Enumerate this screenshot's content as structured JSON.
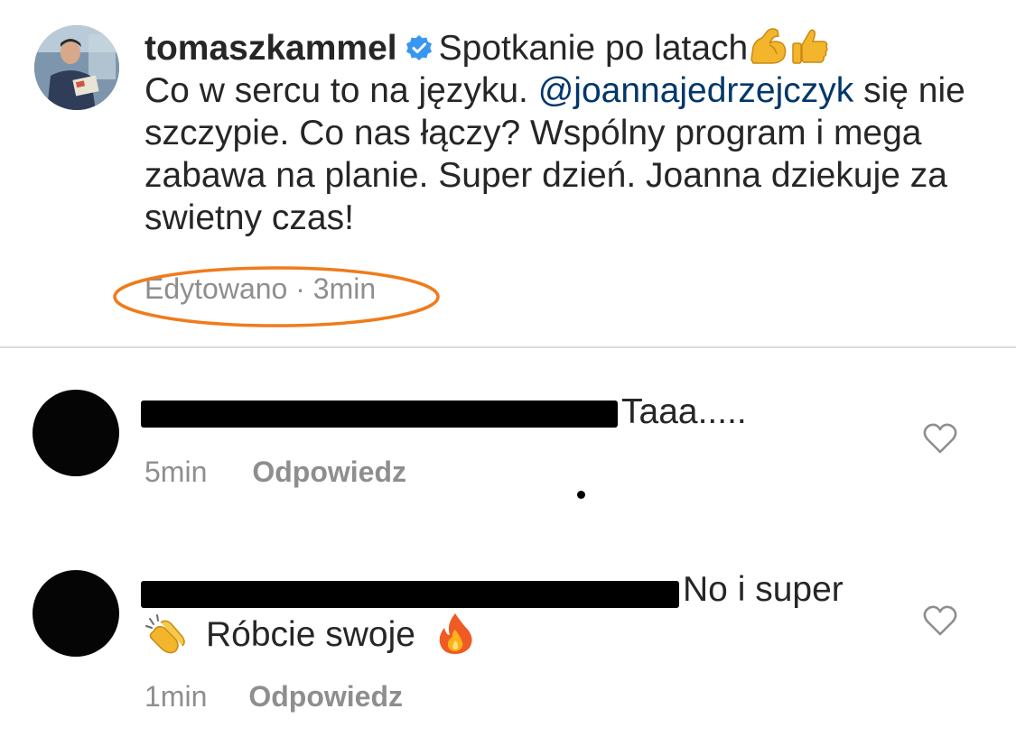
{
  "post": {
    "username": "tomaszkammel",
    "title": "Spotkanie po latach",
    "line1": "Co w sercu to na języku. ",
    "mention": "@joannajedrzejczyk",
    "line2": " się nie szczypie. Co nas łączy? Wspólny program i mega zabawa na planie. Super dzień. Joanna dziekuje za swietny czas!",
    "edited_label": "Edytowano",
    "separator": "·",
    "time": "3min",
    "emojis": [
      "flexed-biceps",
      "thumbs-up"
    ]
  },
  "comments": [
    {
      "text": "Taaa.....",
      "time": "5min",
      "reply_label": "Odpowiedz"
    },
    {
      "text_line1": "No i super",
      "text_line2": "Róbcie swoje",
      "time": "1min",
      "reply_label": "Odpowiedz",
      "emojis": [
        "clapping-hands",
        "fire"
      ]
    }
  ],
  "colors": {
    "text": "#262626",
    "muted": "#8e8e8e",
    "mention": "#00376b",
    "verified": "#3897f0",
    "highlight": "#f07b1b",
    "divider": "#dbdbdb"
  }
}
